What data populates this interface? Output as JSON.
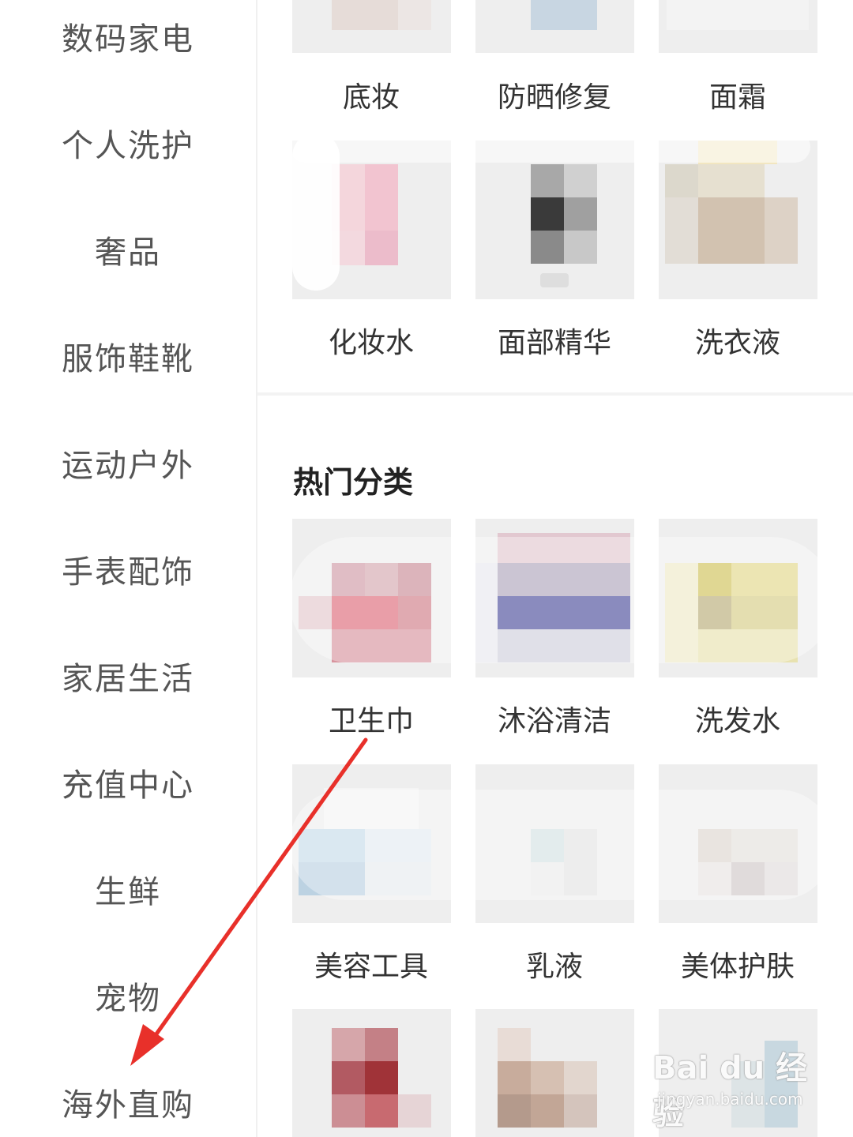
{
  "sidebar": {
    "items": [
      {
        "label": "数码家电"
      },
      {
        "label": "个人洗护"
      },
      {
        "label": "奢品"
      },
      {
        "label": "服饰鞋靴"
      },
      {
        "label": "运动户外"
      },
      {
        "label": "手表配饰"
      },
      {
        "label": "家居生活"
      },
      {
        "label": "充值中心"
      },
      {
        "label": "生鲜"
      },
      {
        "label": "宠物"
      },
      {
        "label": "海外直购"
      }
    ]
  },
  "top_section": {
    "row1": [
      {
        "label": "底妆"
      },
      {
        "label": "防晒修复"
      },
      {
        "label": "面霜"
      }
    ],
    "row2": [
      {
        "label": "化妆水"
      },
      {
        "label": "面部精华"
      },
      {
        "label": "洗衣液"
      }
    ]
  },
  "hot_section": {
    "title": "热门分类",
    "row1": [
      {
        "label": "卫生巾"
      },
      {
        "label": "沐浴清洁"
      },
      {
        "label": "洗发水"
      }
    ],
    "row2": [
      {
        "label": "美容工具"
      },
      {
        "label": "乳液"
      },
      {
        "label": "美体护肤"
      }
    ]
  },
  "watermark": {
    "brand": "Bai du 经验",
    "url": "jingyan.baidu.com"
  },
  "colors": {
    "arrow": "#e8302a",
    "tile_bg": "#eeeeee",
    "sidebar_text": "#555555"
  }
}
